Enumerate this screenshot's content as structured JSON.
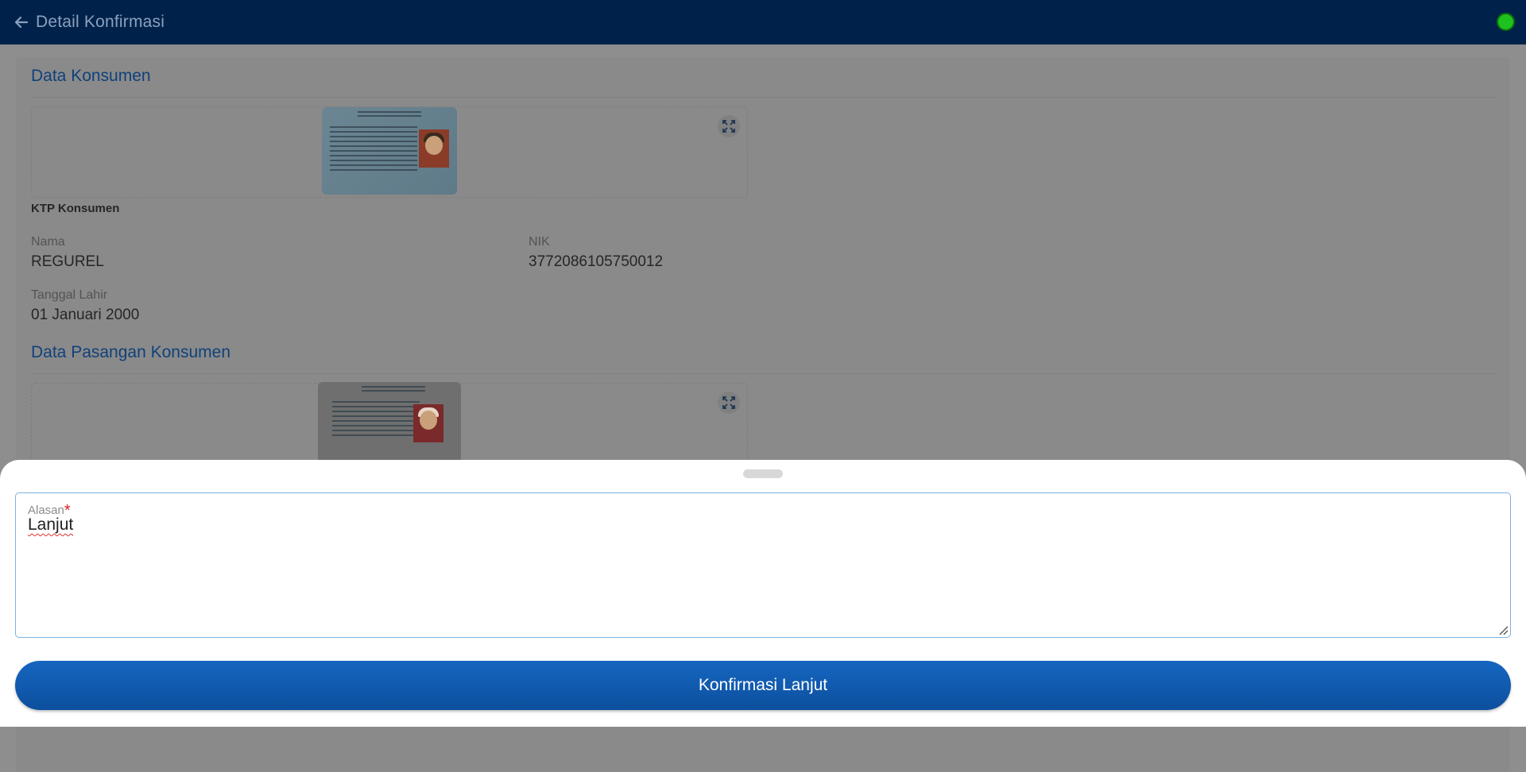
{
  "header": {
    "title": "Detail Konfirmasi",
    "status_color": "#1ec21e"
  },
  "consumer": {
    "section_title": "Data Konsumen",
    "photo_caption": "KTP Konsumen",
    "name_label": "Nama",
    "name_value": "REGUREL",
    "nik_label": "NIK",
    "nik_value": "3772086105750012",
    "dob_label": "Tanggal Lahir",
    "dob_value": "01 Januari 2000"
  },
  "spouse": {
    "section_title": "Data Pasangan Konsumen"
  },
  "sheet": {
    "reason_label": "Alasan",
    "required_mark": "*",
    "reason_value": "Lanjut",
    "confirm_label": "Konfirmasi Lanjut"
  },
  "colors": {
    "primary": "#0d4f9e",
    "header_bg": "#00224a",
    "required": "#e01b1b"
  }
}
